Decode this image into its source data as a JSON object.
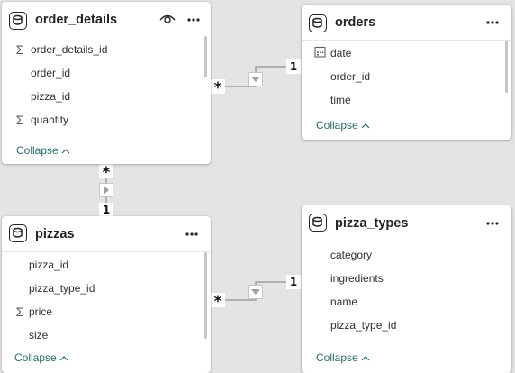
{
  "tables": {
    "order_details": {
      "title": "order_details",
      "fields": [
        {
          "name": "order_details_id",
          "icon": "sigma-icon"
        },
        {
          "name": "order_id",
          "icon": ""
        },
        {
          "name": "pizza_id",
          "icon": ""
        },
        {
          "name": "quantity",
          "icon": "sigma-icon"
        }
      ],
      "collapse_label": "Collapse"
    },
    "orders": {
      "title": "orders",
      "fields": [
        {
          "name": "date",
          "icon": "calendar-icon"
        },
        {
          "name": "order_id",
          "icon": ""
        },
        {
          "name": "time",
          "icon": ""
        }
      ],
      "collapse_label": "Collapse"
    },
    "pizzas": {
      "title": "pizzas",
      "fields": [
        {
          "name": "pizza_id",
          "icon": ""
        },
        {
          "name": "pizza_type_id",
          "icon": ""
        },
        {
          "name": "price",
          "icon": "sigma-icon"
        },
        {
          "name": "size",
          "icon": ""
        }
      ],
      "collapse_label": "Collapse"
    },
    "pizza_types": {
      "title": "pizza_types",
      "fields": [
        {
          "name": "category",
          "icon": ""
        },
        {
          "name": "ingredients",
          "icon": ""
        },
        {
          "name": "name",
          "icon": ""
        },
        {
          "name": "pizza_type_id",
          "icon": ""
        }
      ],
      "collapse_label": "Collapse"
    }
  },
  "relationships": [
    {
      "from": "order_details",
      "to": "orders",
      "from_cardinality": "*",
      "to_cardinality": "1"
    },
    {
      "from": "order_details",
      "to": "pizzas",
      "from_cardinality": "*",
      "to_cardinality": "1"
    },
    {
      "from": "pizzas",
      "to": "pizza_types",
      "from_cardinality": "*",
      "to_cardinality": "1"
    }
  ],
  "icons": {
    "table": "table-icon",
    "more": "more-options-icon",
    "visibility": "eye-icon",
    "collapse": "chevron-up-icon",
    "direction": "filter-direction-icon"
  },
  "colors": {
    "canvas": "#e5e4e2",
    "card": "#ffffff",
    "text": "#252423",
    "collapse": "#2b6b6b"
  }
}
